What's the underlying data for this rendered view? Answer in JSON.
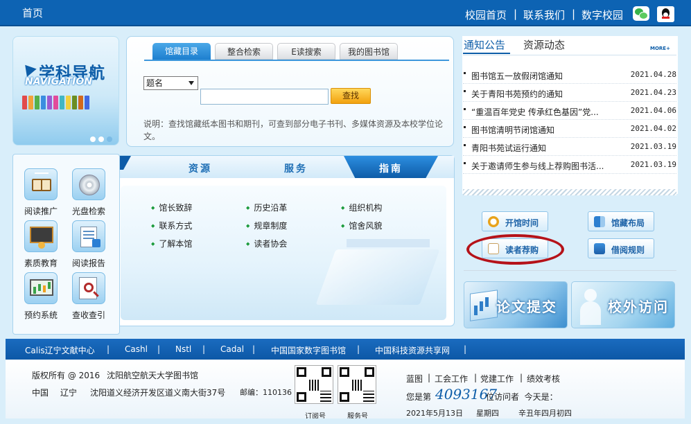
{
  "topbar": {
    "home": "首页",
    "links": [
      "校园首页",
      "联系我们",
      "数字校园"
    ],
    "wechat_icon": "wechat-icon",
    "qq_icon": "qq-icon"
  },
  "banner": {
    "title": "学科导航",
    "subtitle": "NAVIGATION"
  },
  "search": {
    "tabs": [
      "馆藏目录",
      "整合检索",
      "E读搜索",
      "我的图书馆"
    ],
    "active_tab": 0,
    "field_select": "题名",
    "button": "查找",
    "input_value": "",
    "description": "说明：查找馆藏纸本图书和期刊，可查到部分电子书刊、多媒体资源及本校学位论文。"
  },
  "quick_links": [
    {
      "label": "阅读推广",
      "icon": "open-book-icon"
    },
    {
      "label": "光盘检索",
      "icon": "cd-icon"
    },
    {
      "label": "素质教育",
      "icon": "blackboard-icon"
    },
    {
      "label": "阅读报告",
      "icon": "report-icon"
    },
    {
      "label": "预约系统",
      "icon": "monitor-chart-icon"
    },
    {
      "label": "查收查引",
      "icon": "magnifier-doc-icon"
    }
  ],
  "center": {
    "tabs": [
      "资源",
      "服务",
      "指南"
    ],
    "active_tab": 2,
    "links": [
      [
        "馆长致辞",
        "历史沿革",
        "组织机构"
      ],
      [
        "联系方式",
        "规章制度",
        "馆舍风貌"
      ],
      [
        "了解本馆",
        "读者协会",
        ""
      ]
    ]
  },
  "notices": {
    "title": "通知公告",
    "second_title": "资源动态",
    "more": "MORE+",
    "items": [
      {
        "text": "图书馆五一放假闭馆通知",
        "date": "2021.04.28"
      },
      {
        "text": "关于青阳书苑预约的通知",
        "date": "2021.04.23"
      },
      {
        "text": "“重温百年党史 传承红色基因”党...",
        "date": "2021.04.06"
      },
      {
        "text": "图书馆清明节闭馆通知",
        "date": "2021.04.02"
      },
      {
        "text": "青阳书苑试运行通知",
        "date": "2021.03.19"
      },
      {
        "text": "关于邀请师生参与线上荐购图书活...",
        "date": "2021.03.19"
      }
    ]
  },
  "service_buttons": [
    {
      "label": "开馆时间",
      "icon": "clock-icon"
    },
    {
      "label": "馆藏布局",
      "icon": "layout-icon"
    },
    {
      "label": "读者荐购",
      "icon": "edit-icon"
    },
    {
      "label": "借阅规则",
      "icon": "rules-icon"
    }
  ],
  "tiles": [
    "论文提交",
    "校外访问"
  ],
  "footer_links": [
    "Calis辽宁文献中心",
    "Cashl",
    "Nstl",
    "Cadal",
    "中国国家数字图书馆",
    "中国科技资源共享网"
  ],
  "footer": {
    "copyright": "版权所有 @ 2016",
    "org": "沈阳航空航天大学图书馆",
    "country": "中国",
    "province": "辽宁",
    "address": "沈阳道义经济开发区道义南大街37号",
    "postcode": "邮编：110136",
    "qr_labels": [
      "订阅号",
      "服务号"
    ],
    "links": [
      "蓝图",
      "工会工作",
      "党建工作",
      "绩效考核"
    ],
    "visitor_prefix": "您是第",
    "visitor_count": "4093167",
    "visitor_suffix": "位访问者  今天是：",
    "date": "2021年5月13日",
    "weekday": "星期四",
    "lunar": "辛丑年四月初四"
  },
  "colors": {
    "primary": "#0d63b3",
    "accent_orange": "#f2a10e",
    "highlight_red": "#b51219",
    "background": "#d9eefa"
  }
}
